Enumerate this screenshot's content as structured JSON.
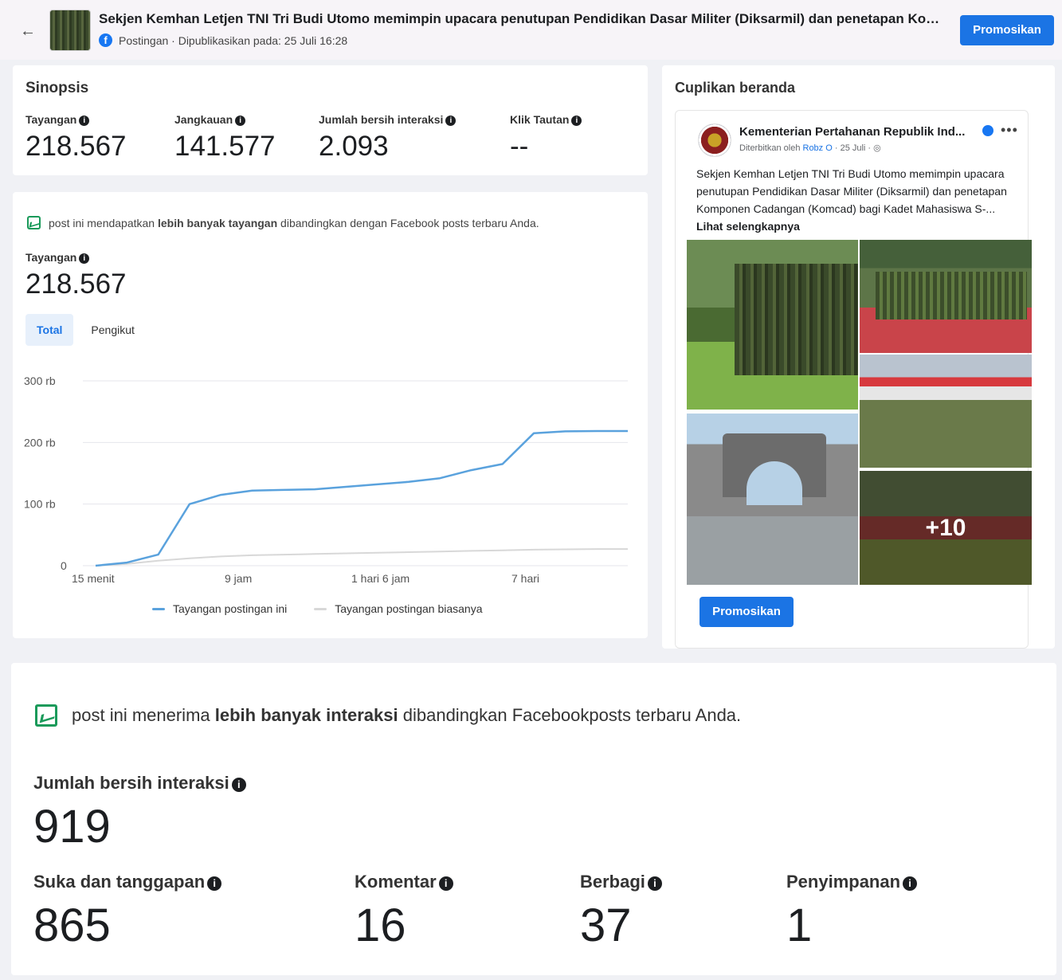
{
  "header": {
    "back_icon": "arrow-left-icon",
    "title": "Sekjen Kemhan Letjen TNI Tri Budi Utomo memimpin upacara penutupan Pendidikan Dasar Militer (Diksarmil) dan penetapan Komp...",
    "meta": "Postingan · Dipublikasikan pada: 25 Juli 16:28",
    "promote_label": "Promosikan"
  },
  "synopsis": {
    "title": "Sinopsis",
    "metrics": [
      {
        "label": "Tayangan",
        "value": "218.567"
      },
      {
        "label": "Jangkauan",
        "value": "141.577"
      },
      {
        "label": "Jumlah bersih interaksi",
        "value": "2.093"
      },
      {
        "label": "Klik Tautan",
        "value": "--"
      }
    ]
  },
  "views": {
    "insight_pre": "post ini mendapatkan ",
    "insight_bold": "lebih banyak tayangan",
    "insight_post": " dibandingkan dengan Facebook posts terbaru Anda.",
    "label": "Tayangan",
    "value": "218.567",
    "tabs": [
      "Total",
      "Pengikut"
    ]
  },
  "chart_data": {
    "type": "line",
    "y_ticks": [
      "300 rb",
      "200 rb",
      "100 rb",
      "0"
    ],
    "ylim": [
      0,
      300000
    ],
    "x_ticks": [
      "15 menit",
      "9 jam",
      "1 hari 6 jam",
      "7 hari"
    ],
    "series": [
      {
        "name": "Tayangan postingan ini",
        "color": "#5aa2dd",
        "values": [
          0,
          5000,
          18000,
          100000,
          115000,
          122000,
          123000,
          124000,
          128000,
          132000,
          136000,
          142000,
          155000,
          165000,
          215000,
          218000,
          218500,
          218567
        ]
      },
      {
        "name": "Tayangan postingan biasanya",
        "color": "#d8d8d8",
        "values": [
          0,
          3000,
          8000,
          12000,
          15000,
          17000,
          18000,
          19000,
          20000,
          21000,
          22000,
          23000,
          24000,
          25000,
          26000,
          26500,
          27000,
          27000
        ]
      }
    ]
  },
  "preview": {
    "title": "Cuplikan beranda",
    "page_name": "Kementerian Pertahanan Republik Ind...",
    "meta_pre": "Diterbitkan oleh ",
    "meta_author": "Robz O",
    "meta_date": " · 25 Juli · ",
    "text": "Sekjen Kemhan Letjen TNI Tri Budi Utomo memimpin upacara penutupan Pendidikan Dasar Militer (Diksarmil) dan penetapan Komponen Cadangan (Komcad) bagi Kadet Mahasiswa S-... ",
    "see_more": "Lihat selengkapnya",
    "more_photos": "+10",
    "promote_label": "Promosikan"
  },
  "interactions": {
    "insight_pre": "post ini menerima ",
    "insight_bold": "lebih banyak interaksi",
    "insight_post": " dibandingkan Facebookposts terbaru Anda.",
    "total_label": "Jumlah bersih interaksi",
    "total_value": "919",
    "metrics": [
      {
        "label": "Suka dan tanggapan",
        "value": "865"
      },
      {
        "label": "Komentar",
        "value": "16"
      },
      {
        "label": "Berbagi",
        "value": "37"
      },
      {
        "label": "Penyimpanan",
        "value": "1"
      }
    ]
  }
}
